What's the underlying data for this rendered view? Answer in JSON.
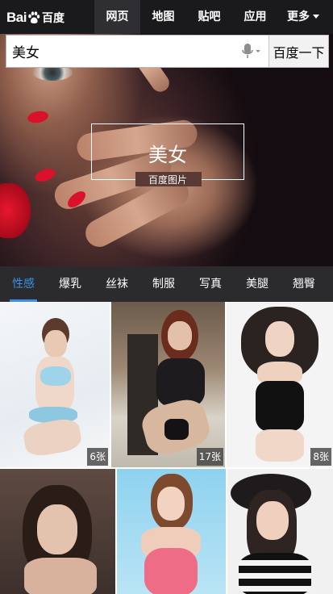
{
  "header": {
    "logo_text": "Bai",
    "logo_cn": "百度",
    "tabs": [
      {
        "label": "网页",
        "active": true
      },
      {
        "label": "地图",
        "active": false
      },
      {
        "label": "贴吧",
        "active": false
      },
      {
        "label": "应用",
        "active": false
      },
      {
        "label": "更多",
        "active": false
      }
    ]
  },
  "search": {
    "value": "美女",
    "button_label": "百度一下",
    "mic_icon": "microphone-icon"
  },
  "hero": {
    "title": "美女",
    "subtitle": "百度图片"
  },
  "categories": [
    {
      "label": "性感",
      "active": true
    },
    {
      "label": "爆乳",
      "active": false
    },
    {
      "label": "丝袜",
      "active": false
    },
    {
      "label": "制服",
      "active": false
    },
    {
      "label": "写真",
      "active": false
    },
    {
      "label": "美腿",
      "active": false
    },
    {
      "label": "翘臀",
      "active": false
    }
  ],
  "photos": [
    {
      "count": "6张"
    },
    {
      "count": "17张"
    },
    {
      "count": "8张"
    },
    {
      "count": ""
    },
    {
      "count": ""
    },
    {
      "count": ""
    }
  ],
  "colors": {
    "topbar": "#1a1a1d",
    "category_bar": "#2b2b2e",
    "accent": "#3b8fe8"
  }
}
